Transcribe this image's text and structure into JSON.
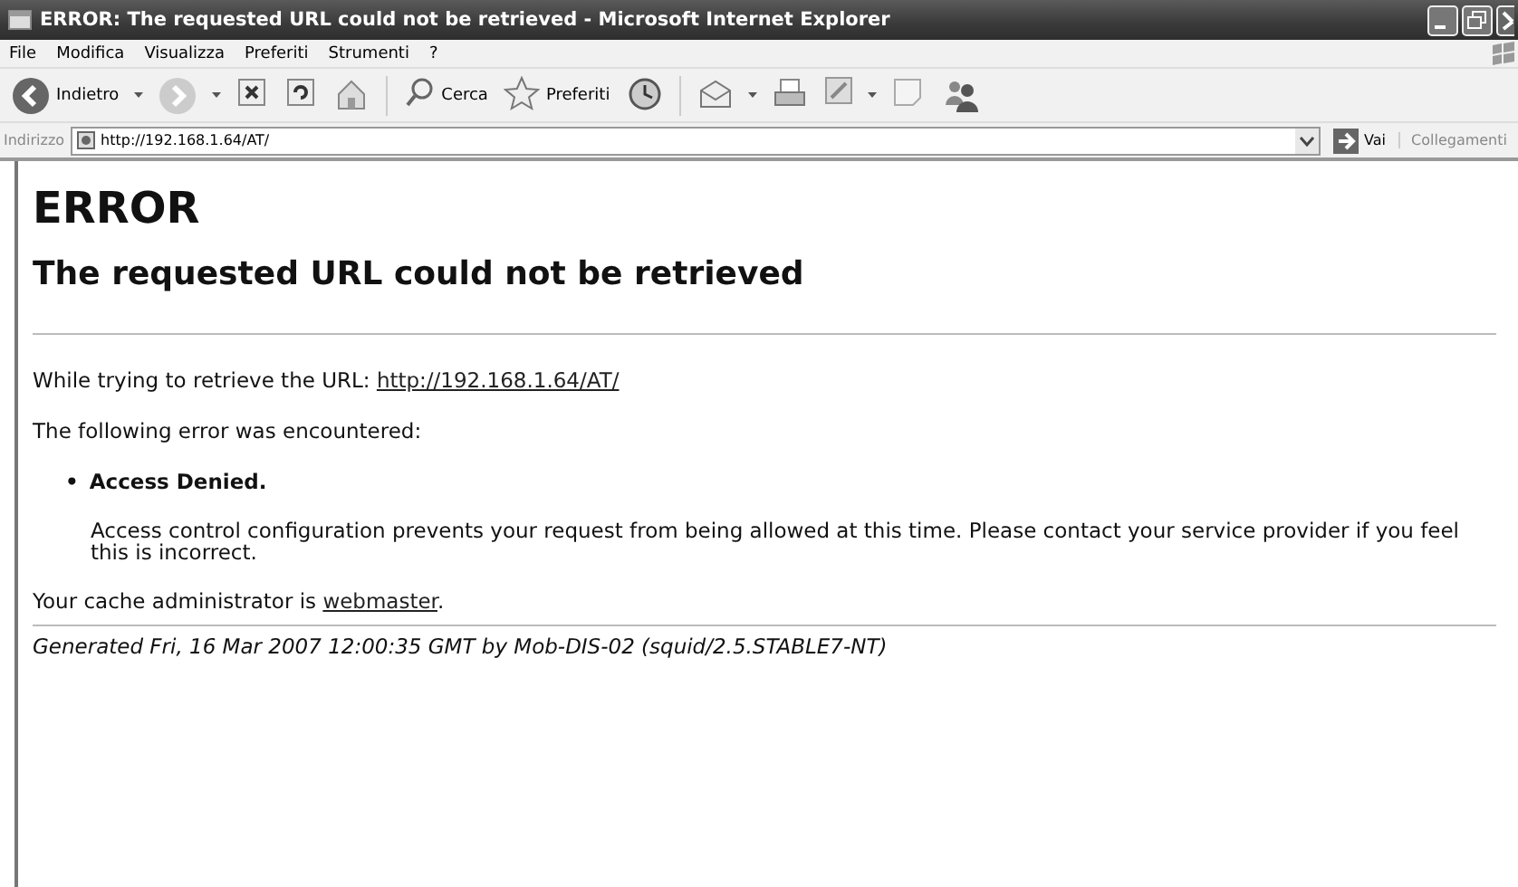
{
  "window": {
    "title": "ERROR: The requested URL could not be retrieved - Microsoft Internet Explorer"
  },
  "menu": [
    "File",
    "Modifica",
    "Visualizza",
    "Preferiti",
    "Strumenti",
    "?"
  ],
  "toolbar": [
    {
      "kind": "back",
      "label": "Indietro"
    },
    {
      "kind": "forward"
    },
    {
      "kind": "stop"
    },
    {
      "kind": "refresh"
    },
    {
      "kind": "home"
    },
    {
      "kind": "separator"
    },
    {
      "kind": "search",
      "label": "Cerca"
    },
    {
      "kind": "favorites",
      "label": "Preferiti"
    },
    {
      "kind": "history"
    },
    {
      "kind": "separator"
    },
    {
      "kind": "mail"
    },
    {
      "kind": "print"
    },
    {
      "kind": "edit"
    },
    {
      "kind": "note"
    },
    {
      "kind": "messenger"
    }
  ],
  "address_bar": {
    "label": "Indirizzo",
    "value": "http://192.168.1.64/AT/",
    "go": "Vai",
    "links": "Collegamenti"
  },
  "page": {
    "heading": "ERROR",
    "subheading": "The requested URL could not be retrieved",
    "url_line": {
      "text": "While trying to retrieve the URL:",
      "link": "http://192.168.1.64/AT/"
    },
    "error_intro": "The following error was encountered:",
    "errors": [
      {
        "marker": "•",
        "title": "Access Denied.",
        "description": "Access control configuration prevents your request from being allowed at this time. Please contact your service provider if you feel this is incorrect."
      }
    ],
    "admin_line": {
      "text": "Your cache administrator is",
      "link": "webmaster",
      "after": "."
    },
    "footer": "Generated Fri, 16 Mar 2007 12:00:35 GMT by Mob-DIS-02 (squid/2.5.STABLE7-NT)"
  }
}
